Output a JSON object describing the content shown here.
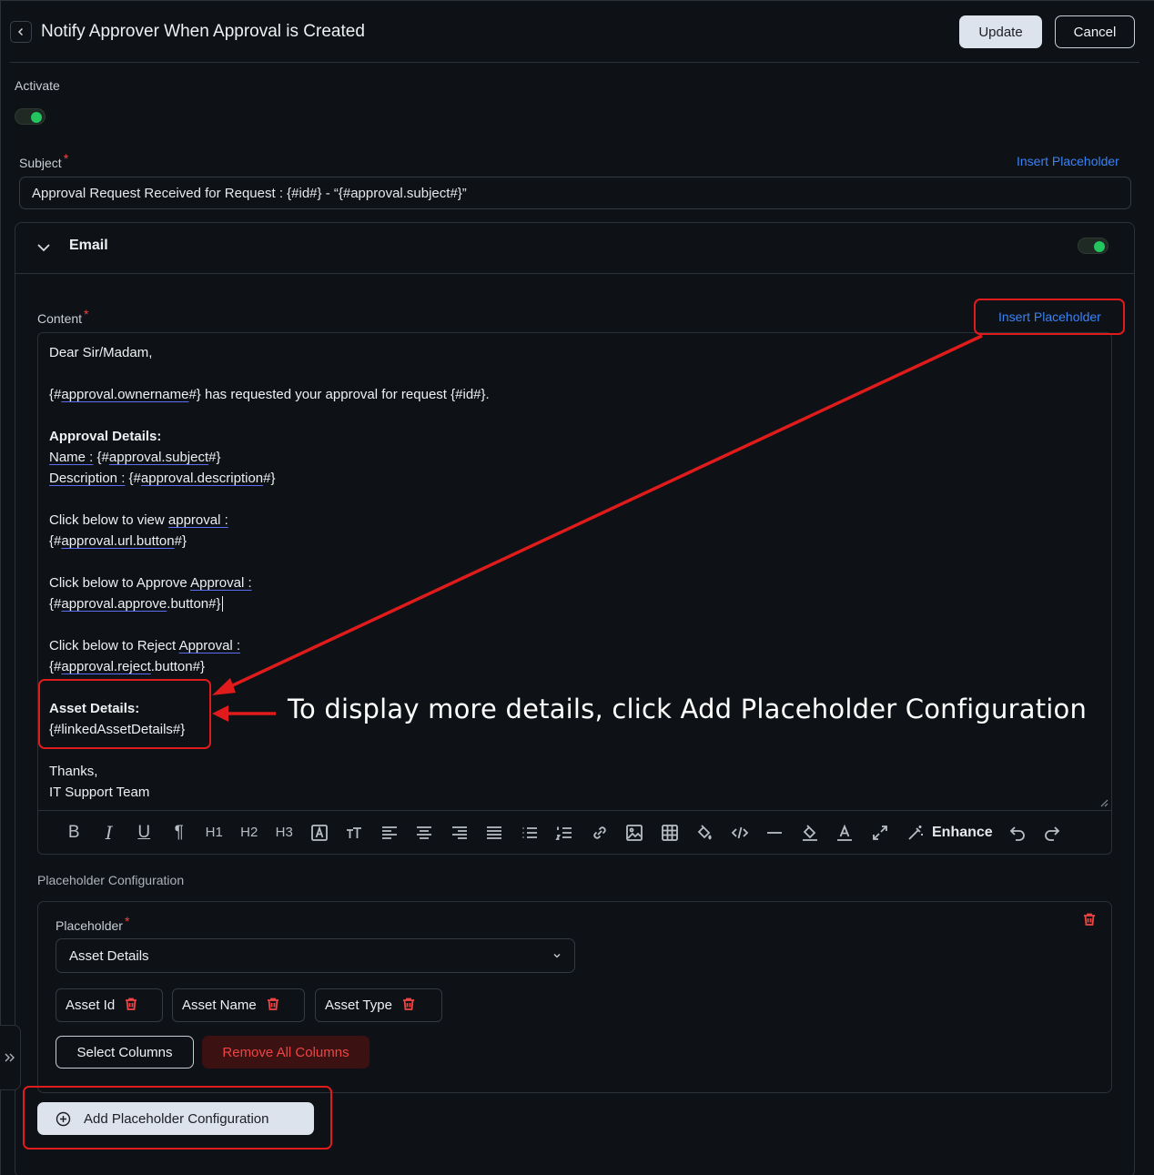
{
  "header": {
    "title": "Notify Approver When Approval is Created",
    "update_label": "Update",
    "cancel_label": "Cancel"
  },
  "activate": {
    "label": "Activate",
    "on": true
  },
  "subject": {
    "label": "Subject",
    "required_mark": "*",
    "insert_placeholder": "Insert Placeholder",
    "value": "Approval Request Received for Request : {#id#} - “{#approval.subject#}”"
  },
  "email": {
    "title": "Email",
    "enabled": true,
    "content_label": "Content",
    "required_mark": "*",
    "insert_placeholder": "Insert Placeholder",
    "content": {
      "greeting": "Dear Sir/Madam,",
      "l1_a": "{#",
      "l1_b": "approval.ownername",
      "l1_c": "#} has requested your approval for request {#id#}.",
      "details_heading": "Approval Details:",
      "name_label": "Name :",
      "name_a": " {#",
      "name_b": "approval.subject",
      "name_c": "#}",
      "desc_label": "Description :",
      "desc_a": " {#",
      "desc_b": "approval.description",
      "desc_c": "#}",
      "view_a": "Click below to view ",
      "view_b": "approval :",
      "view_btn_a": "{#",
      "view_btn_b": "approval.url.button",
      "view_btn_c": "#}",
      "approve_a": "Click below to Approve ",
      "approve_b": "Approval :",
      "approve_btn_a": "{#",
      "approve_btn_b": "approval.approve",
      "approve_btn_c": ".button#}",
      "reject_a": "Click below to Reject ",
      "reject_b": "Approval :",
      "reject_btn_a": "{#",
      "reject_btn_b": "approval.reject",
      "reject_btn_c": ".button#}",
      "asset_heading": "Asset Details:",
      "asset_placeholder": "{#linkedAssetDetails#}",
      "thanks": "Thanks,",
      "signature": "IT Support Team"
    },
    "toolbar": {
      "bold": "B",
      "italic": "I",
      "underline": "U",
      "paragraph": "¶",
      "h1": "H1",
      "h2": "H2",
      "h3": "H3",
      "enhance": "Enhance"
    }
  },
  "placeholder_config": {
    "section_label": "Placeholder Configuration",
    "placeholder_label": "Placeholder",
    "required_mark": "*",
    "selected": "Asset Details",
    "columns": [
      "Asset Id",
      "Asset Name",
      "Asset Type"
    ],
    "select_columns_label": "Select Columns",
    "remove_all_label": "Remove All Columns",
    "add_config_label": "Add Placeholder Configuration"
  },
  "annotation": {
    "text": "To display more details, click Add Placeholder Configuration",
    "color": "#e01b1b"
  }
}
